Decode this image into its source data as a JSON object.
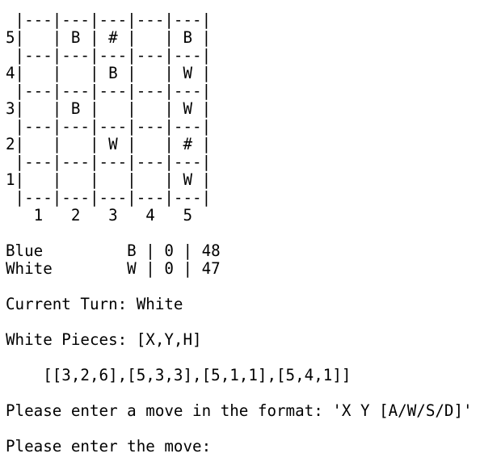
{
  "board": {
    "separator": " |---|---|---|---|---|",
    "rows": [
      "5|   | B | # |   | B |",
      "4|   |   | B |   | W |",
      "3|   | B |   |   | W |",
      "2|   |   | W |   | # |",
      "1|   |   |   |   | W |"
    ],
    "column_labels": "   1   2   3   4   5"
  },
  "scores": [
    "Blue         B | 0 | 48",
    "White        W | 0 | 47"
  ],
  "current_turn": "Current Turn: White",
  "pieces_header": "White Pieces: [X,Y,H]",
  "pieces_list": "    [[3,2,6],[5,3,3],[5,1,1],[5,4,1]]",
  "format_prompt": "Please enter a move in the format: 'X Y [A/W/S/D]'",
  "move_prompt": "Please enter the move: ",
  "move_input_value": ""
}
